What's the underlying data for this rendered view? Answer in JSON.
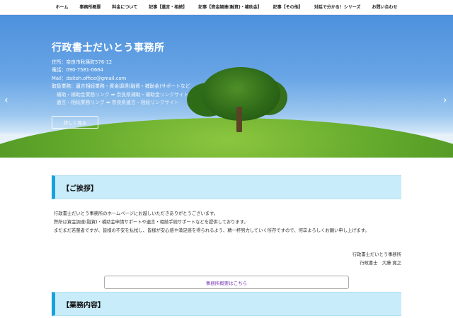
{
  "nav": {
    "items": [
      {
        "label": "ホーム"
      },
      {
        "label": "事務所概要"
      },
      {
        "label": "料金について"
      },
      {
        "label": "記事【遺言・相続】"
      },
      {
        "label": "記事【資金調達(融資)・補助金】"
      },
      {
        "label": "記事【その他】"
      },
      {
        "label": "対話で分かる！シリーズ"
      },
      {
        "label": "お問い合わせ"
      }
    ]
  },
  "hero": {
    "title": "行政書士だいとう事務所",
    "lines": [
      "住所：奈良市秋篠町576-12",
      "電話：090-7581-0664",
      "Mail：daitoh.office@gmail.com",
      "取扱業務：遺言相続業務・資金調達(融資・補助金)サポートなど"
    ],
    "link_lines": [
      "　補助・補助金業務リンク ➡ 奈良県補助・補助金リンクサイト",
      "　遺言・相続業務リンク ➡ 奈良県遺言・相続リンクサイト"
    ],
    "button_label": "詳しく見る",
    "prev_arrow": "‹",
    "next_arrow": "›",
    "slides_total": 3,
    "slide_active_index": 2
  },
  "greeting_section": {
    "heading": "【ご挨拶】",
    "paragraphs": [
      "行政書士だいとう事務所のホームページにお越しいただきありがとうございます。",
      "弊所は資金調達(融資)・補助金申請サポートや遺言・相続手続サポートなどを提供しております。",
      "まだまだ若輩者ですが、皆様の不安を払拭し、皆様が安心感や満足感を得られるよう、精一杯努力していく所存ですので、何卒よろしくお願い申し上げます。"
    ],
    "signature_office": "行政書士だいとう事務所",
    "signature_name": "行政書士　大藤 寛之",
    "overview_button": "事務所概要はこちら"
  },
  "services_section": {
    "heading": "【業務内容】"
  },
  "colors": {
    "section_bg": "#c9ecfb",
    "section_border": "#1aa1dc",
    "button_text": "#7b3db8"
  }
}
